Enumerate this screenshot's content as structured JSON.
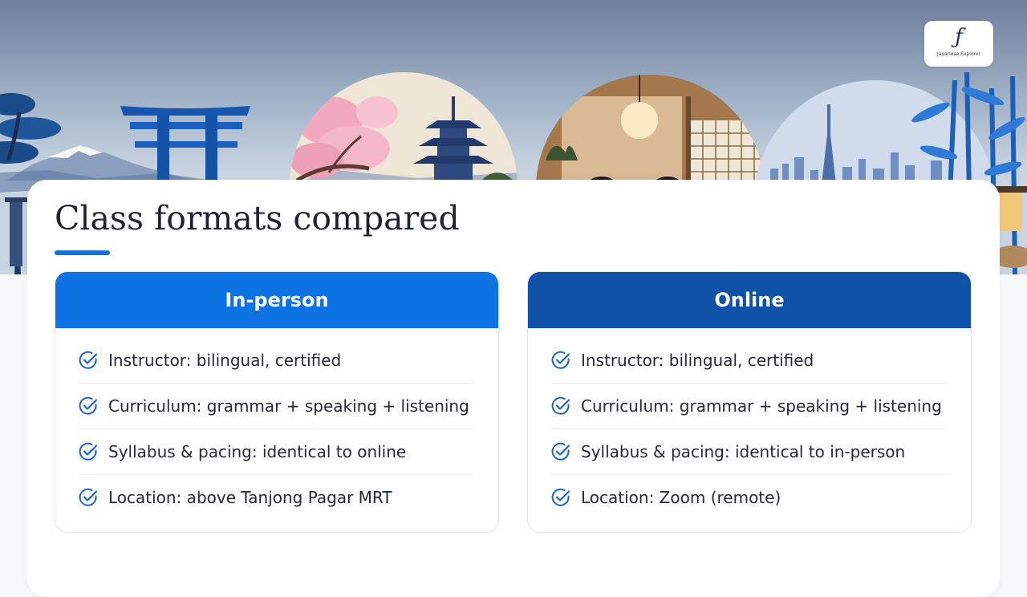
{
  "slide": {
    "title": "Class formats compared",
    "logo_text": "Japanese Explorer"
  },
  "formats": [
    {
      "name": "In-person",
      "color": "#0d72e2",
      "items": [
        "Instructor: bilingual, certified",
        "Curriculum: grammar + speaking + listening",
        "Syllabus & pacing: identical to online",
        "Location: above Tanjong Pagar MRT"
      ]
    },
    {
      "name": "Online",
      "color": "#0f52a8",
      "items": [
        "Instructor: bilingual, certified",
        "Curriculum: grammar + speaking + listening",
        "Syllabus & pacing: identical to in-person",
        "Location: Zoom (remote)"
      ]
    }
  ],
  "icons": {
    "check": "check-circle-icon",
    "logo": "logo-icon"
  }
}
